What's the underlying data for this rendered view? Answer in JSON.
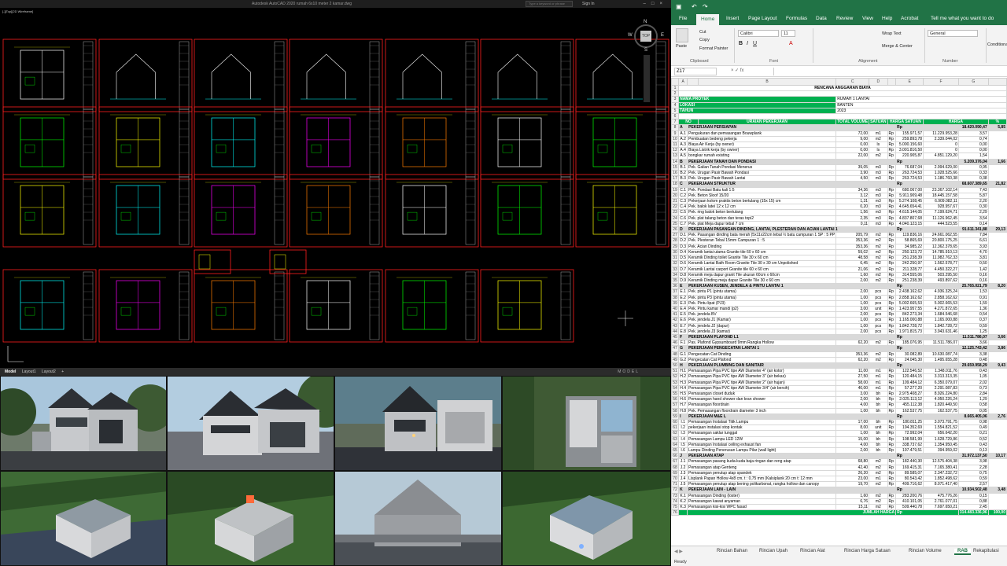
{
  "acad": {
    "title": "Autodesk AutoCAD 2020   rumah 6x10 meter 2 kamar.dwg",
    "search_placeholder": "Type a keyword or phrase",
    "signin": "Sign In",
    "viewport_label": "[-][Top][2D Wireframe]",
    "cube": {
      "top": "TOP",
      "n": "N",
      "w": "W",
      "e": "E",
      "s": "S"
    },
    "tabs": [
      "Model",
      "Layout1",
      "Layout2",
      "+"
    ],
    "status_right": "MODEL"
  },
  "renders": [
    "render-front-left",
    "render-front-angle",
    "render-front-right",
    "render-top-view",
    "render-aerial-rear-left",
    "render-aerial-rear-right",
    "render-side-gable",
    "render-aerial-side"
  ],
  "excel": {
    "menu": [
      "File",
      "Home",
      "Insert",
      "Page Layout",
      "Formulas",
      "Data",
      "Review",
      "View",
      "Help",
      "Acrobat",
      "Tell me what you want to do"
    ],
    "clipboard": {
      "paste": "Paste",
      "cut": "Cut",
      "copy": "Copy",
      "format_painter": "Format Painter",
      "group": "Clipboard"
    },
    "font": {
      "name": "Calibri",
      "size": "11",
      "group": "Font"
    },
    "alignment": {
      "wrap": "Wrap Text",
      "merge": "Merge & Center",
      "group": "Alignment"
    },
    "number": {
      "format": "General",
      "group": "Number"
    },
    "styles": {
      "cond": "Conditional Formatting"
    },
    "namebox": "Z17",
    "cols": [
      "A",
      "B",
      "C",
      "D",
      "E",
      "F",
      "G"
    ],
    "title": "RENCANA ANGGARAN BIAYA",
    "meta": [
      [
        "NAMA PROYEK",
        "RUMAH 1 LANTAI"
      ],
      [
        "LOKASI",
        "BANTEN"
      ],
      [
        "TAHUN",
        "2023"
      ]
    ],
    "header": [
      "NO",
      "URAIAN PEKERJAAN",
      "TOTAL VOLUME",
      "SATUAN",
      "HARGA SATUAN",
      "HARGA",
      "%"
    ],
    "rows": [
      [
        "8",
        "A",
        "PEKERJAAN PERSIAPAN",
        "",
        "",
        "Rp",
        "18.420.090,47",
        "5,85",
        "sec"
      ],
      [
        "9",
        "A.1",
        "Pengukuran dan pemasangan Bouwplank",
        "72,00",
        "m1",
        "Rp",
        "155.971,57",
        "11.229.953,28",
        "3,57"
      ],
      [
        "10",
        "A.2",
        "Pembuatan bedeng pekerja",
        "9,00",
        "m2",
        "Rp",
        "259.893,78",
        "2.339.044,02",
        "0,74"
      ],
      [
        "11",
        "A.3",
        "Biaya Air Kerja (by owner)",
        "0,00",
        "ls",
        "Rp",
        "5.000.156,60",
        "0",
        "0,00"
      ],
      [
        "12",
        "A.4",
        "Biaya Listrik kerja (by owner)",
        "0,00",
        "ls",
        "Rp",
        "3.001.816,50",
        "0",
        "0,00"
      ],
      [
        "13",
        "A.5",
        "bongkar rumah existing",
        "22,00",
        "m2",
        "Rp",
        "220.905,87",
        "4.851.129,20",
        "1,54"
      ],
      [
        "14",
        "B",
        "PEKERJAAN TANAH DAN PONDASI",
        "",
        "",
        "Rp",
        "5.209.376,04",
        "1,66",
        "sec"
      ],
      [
        "15",
        "B.1",
        "Pek. Galian Tanah Pondasi Menerus",
        "39,05",
        "m3",
        "Rp",
        "76.687,04",
        "2.994.629,00",
        "0,95"
      ],
      [
        "16",
        "B.2",
        "Pek. Urugan Pasir Bawah Pondasi",
        "3,90",
        "m3",
        "Rp",
        "263.724,53",
        "1.028.525,66",
        "0,33"
      ],
      [
        "17",
        "B.3",
        "Pek. Urugan Pasir Bawah Lantai",
        "4,50",
        "m3",
        "Rp",
        "263.724,53",
        "1.186.760,38",
        "0,38"
      ],
      [
        "18",
        "C",
        "PEKERJAAN STRUKTUR",
        "",
        "",
        "Rp",
        "68.607.389,65",
        "21,82",
        "sec"
      ],
      [
        "19",
        "C.1",
        "Pek. Pondasi Batu kali 1:5",
        "34,36",
        "m3",
        "Rp",
        "680.067,00",
        "23.367.102,14",
        "7,43"
      ],
      [
        "20",
        "C.2",
        "Pek. Beton Sloof 15/20",
        "3,12",
        "m3",
        "Rp",
        "5.911.909,48",
        "18.445.157,58",
        "5,87"
      ],
      [
        "21",
        "C.3",
        "Pekerjaan kolom praktis beton bertulang (15x 15) cm",
        "1,31",
        "m3",
        "Rp",
        "5.274.108,45",
        "6.909.082,11",
        "2,20"
      ],
      [
        "22",
        "C.4",
        "Pek. balok latei 12 x 12 cm",
        "0,20",
        "m3",
        "Rp",
        "4.645.654,41",
        "928.957,67",
        "0,30"
      ],
      [
        "23",
        "C.5",
        "Pek. ring balok beton bertulang",
        "1,56",
        "m3",
        "Rp",
        "4.615.144,05",
        "7.199.624,71",
        "2,29"
      ],
      [
        "24",
        "C.6",
        "Pek. plat talang beton dan teras topi2",
        "2,35",
        "m3",
        "Rp",
        "4.837.807,68",
        "11.126.962,45",
        "3,54"
      ],
      [
        "25",
        "C.7",
        "Pek. plat Meja dapur tebal 7 cm",
        "0,11",
        "m3",
        "Rp",
        "4.040.123,15",
        "444.523,55",
        "0,14"
      ],
      [
        "26",
        "D",
        "PEKERJAAN PASANGAN DINDING, LANTAI, PLESTERAN DAN ACIAN LANTAI 1",
        "",
        "",
        "Rp",
        "91.611.341,88",
        "29,13",
        "sec2"
      ],
      [
        "27",
        "D.1",
        "Pek. Pasangan dinding bata merah (5x11x22cm tebal ½ batu campuran 1 SP : 5 PP",
        "205,79",
        "m2",
        "Rp",
        "119.836,16",
        "24.661.062,55",
        "7,84"
      ],
      [
        "28",
        "D.2",
        "Pek. Plesteran Tebal 15mm Campuran 1 : 5",
        "353,36",
        "m2",
        "Rp",
        "58.865,69",
        "20.800.175,25",
        "6,61"
      ],
      [
        "29",
        "D.3",
        "Pek. Acian Dinding",
        "353,36",
        "m2",
        "Rp",
        "34.985,22",
        "12.362.378,65",
        "3,93"
      ],
      [
        "30",
        "D.4",
        "Keramik lantai utama Granite tile 60 x 60 cm",
        "59,02",
        "m2",
        "Rp",
        "250.123,72",
        "14.785.910,13",
        "4,70"
      ],
      [
        "31",
        "D.5",
        "Keramik Dinding toilet Granite Tile 30 x 60 cm",
        "48,58",
        "m2",
        "Rp",
        "251.238,39",
        "11.982.762,33",
        "3,81"
      ],
      [
        "32",
        "D.6",
        "Keramik Lantai Bath Room Granite Tile 30 x 30 cm Unpolished",
        "6,45",
        "m2",
        "Rp",
        "242.250,97",
        "1.562.578,77",
        "0,50"
      ],
      [
        "33",
        "D.7",
        "Keramik Lantai carport Granite tile 60 x 60 cm",
        "21,06",
        "m2",
        "Rp",
        "211.328,77",
        "4.450.322,27",
        "1,42"
      ],
      [
        "34",
        "D.8",
        "Keramik meja dapur granit Tile ukuran 60cm x 60cm",
        "1,60",
        "m2",
        "Rp",
        "314.555,06",
        "503.295,50",
        "0,16"
      ],
      [
        "35",
        "D.9",
        "Keramik Dinding meja dapur Granite Tile 30 x 60 cm",
        "2,00",
        "m2",
        "Rp",
        "251.238,39",
        "493.897,62",
        "0,16"
      ],
      [
        "36",
        "E",
        "PEKERJAAN KUSEN, JENDELA & PINTU LANTAI 1",
        "",
        "",
        "Rp",
        "25.765.021,79",
        "8,20",
        "sec"
      ],
      [
        "37",
        "E.1",
        "Pek. pintu P1 (pintu utama)",
        "2,00",
        "pcs",
        "Rp",
        "2.438.162,62",
        "4.936.325,24",
        "1,53"
      ],
      [
        "38",
        "E.2",
        "Pek. pintu P3 (pintu utama)",
        "1,00",
        "pcs",
        "Rp",
        "2.858.162,62",
        "2.858.162,62",
        "0,91"
      ],
      [
        "39",
        "E.3",
        "Pek. Pintu lipat (PJ3)",
        "1,00",
        "pcs",
        "Rp",
        "5.002.665,53",
        "5.002.665,53",
        "1,59"
      ],
      [
        "40",
        "E.4",
        "Pek. Pintu kamar mandi (p2)",
        "3,00",
        "unit",
        "Rp",
        "1.423.957,55",
        "4.271.872,65",
        "1,36"
      ],
      [
        "41",
        "E.5",
        "Pek. jendela BV",
        "2,00",
        "pcs",
        "Rp",
        "842.273,34",
        "1.684.546,68",
        "0,54"
      ],
      [
        "42",
        "E.6",
        "Pek. jendela J1 (Kamar)",
        "1,00",
        "pcs",
        "Rp",
        "1.165.000,88",
        "1.165.000,88",
        "0,37"
      ],
      [
        "43",
        "E.7",
        "Pek. jendela J2 (dapur)",
        "1,00",
        "pcs",
        "Rp",
        "1.842.728,72",
        "1.842.728,72",
        "0,59"
      ],
      [
        "44",
        "E.8",
        "Pek. jendela J3 (kamar)",
        "2,00",
        "pcs",
        "Rp",
        "1.971.815,73",
        "3.943.631,46",
        "1,25"
      ],
      [
        "45",
        "F",
        "PEKERJAAN PLAFOND L1",
        "",
        "",
        "Rp",
        "11.511.786,07",
        "3,66",
        "sec"
      ],
      [
        "46",
        "F.1",
        "Pas. Plafond Gypsumboard 9mm Rangka Hollow",
        "62,20",
        "m2",
        "Rp",
        "185.076,95",
        "11.511.786,07",
        "3,66"
      ],
      [
        "47",
        "G",
        "PEKERJAAN PENGECATAN LANTAI 1",
        "",
        "",
        "Rp",
        "12.125.743,42",
        "3,86",
        "sec"
      ],
      [
        "48",
        "G.1",
        "Pengecatan Cat Dinding",
        "353,36",
        "m2",
        "Rp",
        "30.082,89",
        "10.630.087,74",
        "3,38"
      ],
      [
        "49",
        "G.2",
        "Pengecatan Cat Plafond",
        "62,20",
        "m2",
        "Rp",
        "24.045,30",
        "1.495.655,28",
        "0,48"
      ],
      [
        "50",
        "H",
        "PEKERJAAN PLUMBING DAN SANITAIR",
        "",
        "",
        "Rp",
        "29.659.958,29",
        "9,43",
        "sec"
      ],
      [
        "51",
        "H.1",
        "Pemasangan Pipa PVC tipe AW Diameter 4\" (air kotor)",
        "11,00",
        "m1",
        "Rp",
        "122.546,52",
        "1.348.011,76",
        "0,43"
      ],
      [
        "52",
        "H.2",
        "Pemasangan Pipa PVC tipe AW Diameter 3\" (air bekas)",
        "27,50",
        "m1",
        "Rp",
        "120.484,15",
        "3.313.313,35",
        "1,05"
      ],
      [
        "53",
        "H.3",
        "Pemasangan Pipa PVC tipe AW Diameter 2\" (air hujan)",
        "58,00",
        "m1",
        "Rp",
        "109.484,12",
        "6.350.079,07",
        "2,02"
      ],
      [
        "54",
        "H.4",
        "Pemasangan Pipa PVC tipe AW Diameter 3/4\" (air bersih)",
        "40,00",
        "m1",
        "Rp",
        "57.277,20",
        "2.291.087,83",
        "0,73"
      ],
      [
        "55",
        "H.5",
        "Pemasangan closet duduk",
        "3,00",
        "bh",
        "Rp",
        "2.975.408,27",
        "8.926.224,80",
        "2,84"
      ],
      [
        "56",
        "H.6",
        "Pemasangan hand shower dan kran shower",
        "2,00",
        "bh",
        "Rp",
        "2.025.113,12",
        "4.050.226,24",
        "1,29"
      ],
      [
        "57",
        "H.7",
        "Pemasangan floordrain",
        "4,00",
        "bh",
        "Rp",
        "455.112,38",
        "1.820.449,50",
        "0,58"
      ],
      [
        "58",
        "H.8",
        "Pek. Pemasangan floordrain diameter 3 inch",
        "1,00",
        "bh",
        "Rp",
        "162.537,75",
        "162.537,75",
        "0,05"
      ],
      [
        "59",
        "I",
        "PEKERJAAN M&E L",
        "",
        "",
        "Rp",
        "8.665.405,06",
        "2,76",
        "sec"
      ],
      [
        "60",
        "I.1",
        "Pemasangan Instalasi Titik Lampu",
        "17,00",
        "bh",
        "Rp",
        "180.811,25",
        "3.073.791,75",
        "0,98"
      ],
      [
        "61",
        "I.2",
        "pekerjaan instalasi stop kontak",
        "8,00",
        "unit",
        "Rp",
        "194.352,69",
        "1.554.821,52",
        "0,49"
      ],
      [
        "62",
        "I.3",
        "Pemasangan saklar tunggal",
        "1,00",
        "bh",
        "Rp",
        "72.992,04",
        "656.642,20",
        "0,21"
      ],
      [
        "63",
        "I.4",
        "Pemasangan Lampu LED 12W",
        "15,00",
        "bh",
        "Rp",
        "108.581,99",
        "1.628.729,86",
        "0,52"
      ],
      [
        "64",
        "I.5",
        "Pemasangan Instalasi ceiling exhaust fan",
        "4,00",
        "bh",
        "Rp",
        "338.737,62",
        "1.354.950,45",
        "0,43"
      ],
      [
        "65",
        "I.6",
        "Lampu Dinding Penerusan Lampu Pilar (wall light)",
        "2,00",
        "bh",
        "Rp",
        "197.479,51",
        "394.959,02",
        "0,13"
      ],
      [
        "66",
        "J",
        "PEKERJAAN ATAP",
        "",
        "",
        "Rp",
        "31.972.137,50",
        "10,17",
        "sec"
      ],
      [
        "67",
        "J.1",
        "Pemasangan pasang kuda-kuda baja ringan dan reng atap",
        "68,80",
        "m2",
        "Rp",
        "182.440,30",
        "12.575.404,38",
        "3,98"
      ],
      [
        "68",
        "J.2",
        "Pemasangan atap Genteng",
        "42,40",
        "m2",
        "Rp",
        "169.415,31",
        "7.165.380,41",
        "2,28"
      ],
      [
        "69",
        "J.3",
        "Pemasangan penutup atap spandek",
        "26,20",
        "m2",
        "Rp",
        "89.585,07",
        "2.347.232,72",
        "0,75"
      ],
      [
        "70",
        "J.4",
        "Lisplank Papan Hollow 4x8 cm, t : 0,75 mm (Kalsiplank 20 cm t: 12 mm",
        "23,00",
        "m1",
        "Rp",
        "80.543,42",
        "1.852.498,62",
        "0,59"
      ],
      [
        "71",
        "J.5",
        "Pemasangan penutup atap bening polikarbonat, rangka hollow dan canopy",
        "19,70",
        "m2",
        "Rp",
        "409.716,62",
        "8.071.417,40",
        "2,57"
      ],
      [
        "72",
        "K",
        "PEKERJAAN LAIN - LAIN",
        "",
        "",
        "Rp",
        "10.934.502,48",
        "3,48",
        "sec"
      ],
      [
        "73",
        "K.1",
        "Pemasangan Dinding (loster)",
        "1,60",
        "m2",
        "Rp",
        "283.200,76",
        "475.776,26",
        "0,15"
      ],
      [
        "74",
        "K.2",
        "Pemasangan kawat anyaman",
        "6,76",
        "m2",
        "Rp",
        "410.101,05",
        "2.761.077,01",
        "0,88"
      ],
      [
        "75",
        "K.3",
        "Pemasangan kisi-kisi WPC fasad",
        "15,11",
        "m2",
        "Rp",
        "509.440,78",
        "7.697.650,21",
        "2,45"
      ]
    ],
    "total": [
      "76",
      "",
      "JUMLAH HARGA",
      "Rp",
      "314.483.336,96",
      "100,00"
    ],
    "sheets": [
      "Rincian Bahan",
      "Rincian Upah",
      "Rincian Alat",
      "Rincian Harga Satuan",
      "Rincian Volume",
      "RAB",
      "Rekapitulasi"
    ],
    "status": "Ready"
  }
}
